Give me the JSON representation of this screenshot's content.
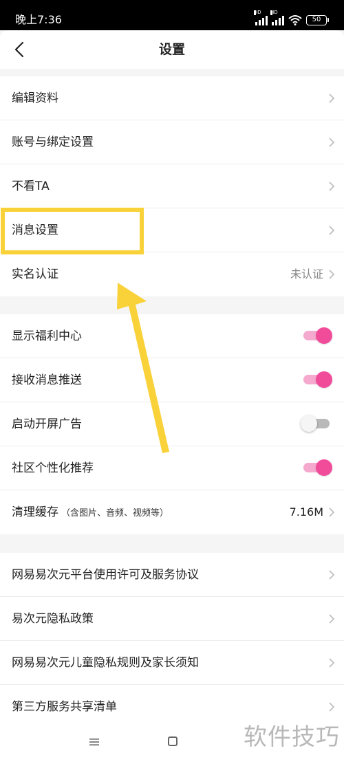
{
  "status_bar": {
    "time": "晚上7:36",
    "signal_tag": "HD",
    "battery": "50"
  },
  "header": {
    "title": "设置"
  },
  "groups": [
    {
      "items": [
        {
          "label": "编辑资料"
        },
        {
          "label": "账号与绑定设置"
        },
        {
          "label": "不看TA"
        },
        {
          "label": "消息设置"
        },
        {
          "label": "实名认证",
          "value": "未认证"
        }
      ]
    },
    {
      "items": [
        {
          "label": "显示福利中心",
          "toggle": true
        },
        {
          "label": "接收消息推送",
          "toggle": true
        },
        {
          "label": "启动开屏广告",
          "toggle": false
        },
        {
          "label": "社区个性化推荐",
          "toggle": true
        },
        {
          "label": "清理缓存",
          "sublabel": "（含图片、音频、视频等）",
          "value": "7.16M"
        }
      ]
    },
    {
      "items": [
        {
          "label": "网易易次元平台使用许可及服务协议"
        },
        {
          "label": "易次元隐私政策"
        },
        {
          "label": "网易易次元儿童隐私规则及家长须知"
        },
        {
          "label": "第三方服务共享清单"
        }
      ]
    }
  ],
  "colors": {
    "accent": "#f04c9a",
    "highlight": "#f9d23a",
    "divider": "#ececec"
  },
  "icons": [
    "back-arrow-icon",
    "chevron-right-icon",
    "menu-icon",
    "home-icon",
    "wifi-icon",
    "battery-icon",
    "signal-icon"
  ],
  "watermark": "软件技巧"
}
